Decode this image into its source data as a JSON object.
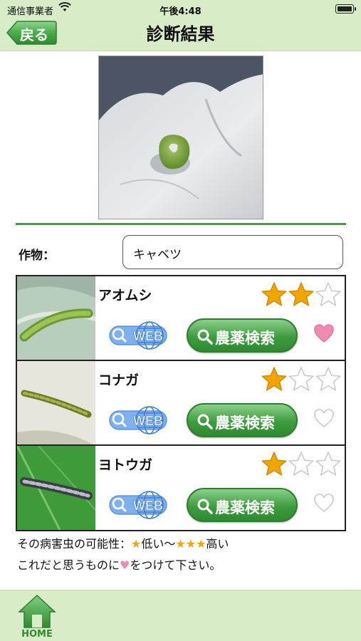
{
  "status": {
    "carrier": "通信事業者",
    "time": "午後4:48"
  },
  "nav": {
    "back_label": "戻る",
    "title": "診断結果"
  },
  "crop": {
    "label": "作物：",
    "value": "キャベツ"
  },
  "results": [
    {
      "name": "アオムシ",
      "rating": 2,
      "max_rating": 3,
      "favorite": true,
      "web_label": "WEB",
      "search_label": "農薬検索"
    },
    {
      "name": "コナガ",
      "rating": 1,
      "max_rating": 3,
      "favorite": false,
      "web_label": "WEB",
      "search_label": "農薬検索"
    },
    {
      "name": "ヨトウガ",
      "rating": 1,
      "max_rating": 3,
      "favorite": false,
      "web_label": "WEB",
      "search_label": "農薬検索"
    }
  ],
  "note": {
    "line1_prefix": "その病害虫の可能性：",
    "line1_star1": "★",
    "line1_low": "低い〜",
    "line1_star3": "★★★",
    "line1_high": "高い",
    "line2_prefix": "これだと思うものに",
    "line2_heart": "♥",
    "line2_suffix": "をつけて下さい。"
  },
  "footer": {
    "home_label": "HOME"
  },
  "colors": {
    "accent_green": "#3aa53a",
    "bar_bg": "#d9ecc8",
    "star_fill": "#f0a500",
    "heart_fill": "#ef8bb0"
  }
}
